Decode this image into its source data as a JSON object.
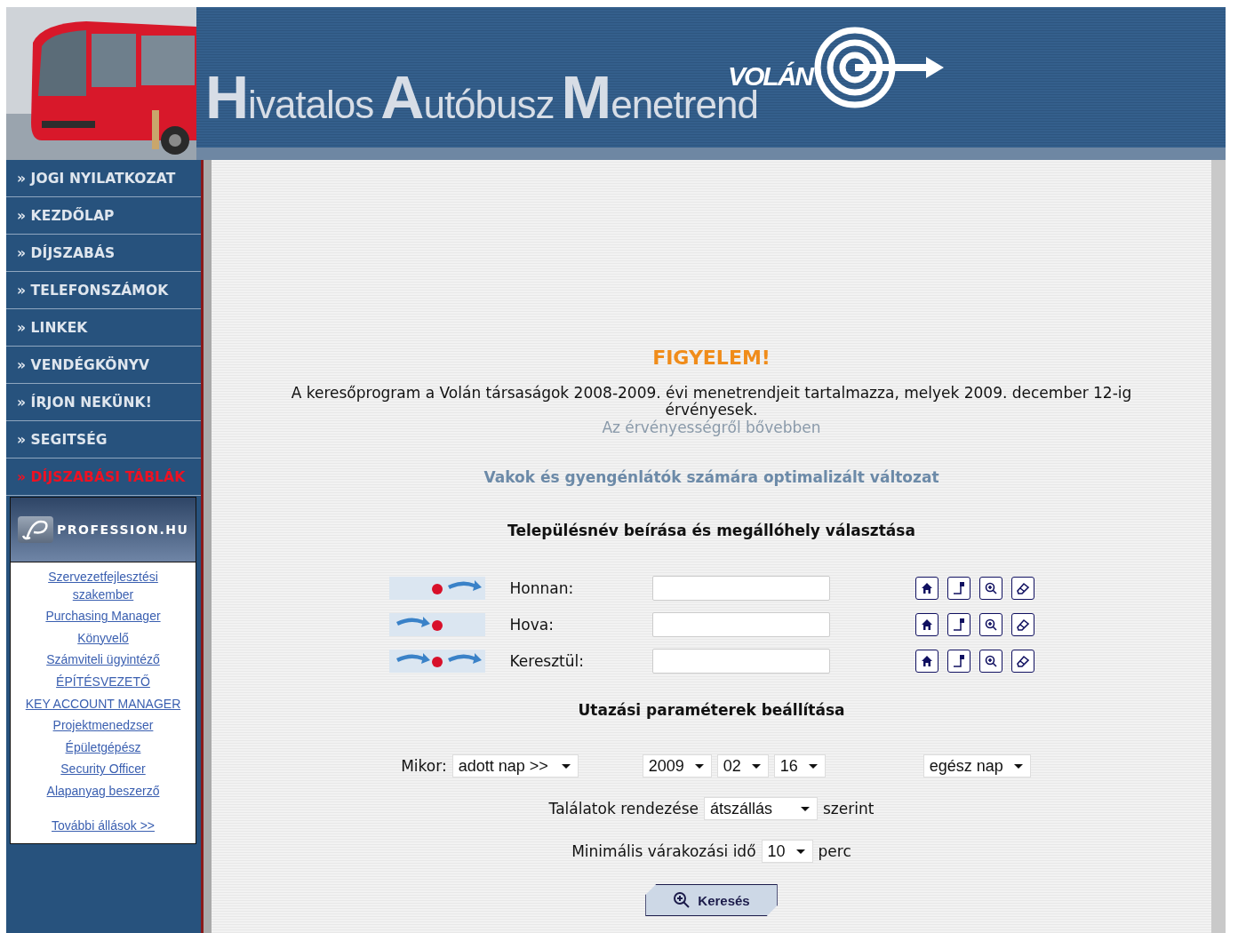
{
  "header": {
    "title_words": [
      "Hivatalos",
      "Autóbusz",
      "Menetrend"
    ],
    "logo": "VOLÁN"
  },
  "nav": [
    {
      "label": "» JOGI NYILATKOZAT",
      "highlighted": false
    },
    {
      "label": "» KEZDŐLAP",
      "highlighted": false
    },
    {
      "label": "» DÍJSZABÁS",
      "highlighted": false
    },
    {
      "label": "» TELEFONSZÁMOK",
      "highlighted": false
    },
    {
      "label": "» LINKEK",
      "highlighted": false
    },
    {
      "label": "» VENDÉGKÖNYV",
      "highlighted": false
    },
    {
      "label": "» ÍRJON NEKÜNK!",
      "highlighted": false
    },
    {
      "label": "» SEGITSÉG",
      "highlighted": false
    },
    {
      "label": "» DÍJSZABÁSI TÁBLÁK",
      "highlighted": true
    }
  ],
  "jobs_box": {
    "logo": "PROFESSION.HU",
    "jobs": [
      "Szervezetfejlesztési szakember",
      "Purchasing Manager",
      "Könyvelő",
      "Számviteli ügyintéző",
      "ÉPÍTÉSVEZETŐ",
      "KEY ACCOUNT MANAGER",
      "Projektmenedzser",
      "Épületgépész",
      "Security Officer",
      "Alapanyag beszerző"
    ],
    "more": "További állások >>"
  },
  "notice": {
    "title": "FIGYELEM!",
    "text": "A keresőprogram a Volán társaságok 2008-2009. évi menetrendjeit tartalmazza, melyek 2009. december 12-ig érvényesek.",
    "link": "Az érvényességről bővebben"
  },
  "accessible_link": "Vakok és gyengénlátók számára optimalizált változat",
  "stops_heading": "Településnév beírása és megállóhely választása",
  "stops": [
    {
      "kind": "from",
      "label": "Honnan:"
    },
    {
      "kind": "to",
      "label": "Hova:"
    },
    {
      "kind": "via",
      "label": "Keresztül:"
    }
  ],
  "params_heading": "Utazási paraméterek beállítása",
  "when": {
    "label": "Mikor:",
    "mode": "adott nap >>",
    "year": "2009",
    "month": "02",
    "day": "16",
    "period": "egész nap"
  },
  "sort": {
    "label": "Találatok rendezése",
    "value": "átszállás",
    "suffix": "szerint"
  },
  "wait": {
    "label": "Minimális várakozási idő",
    "value": "10",
    "suffix": "perc"
  },
  "search_button": "Keresés"
}
